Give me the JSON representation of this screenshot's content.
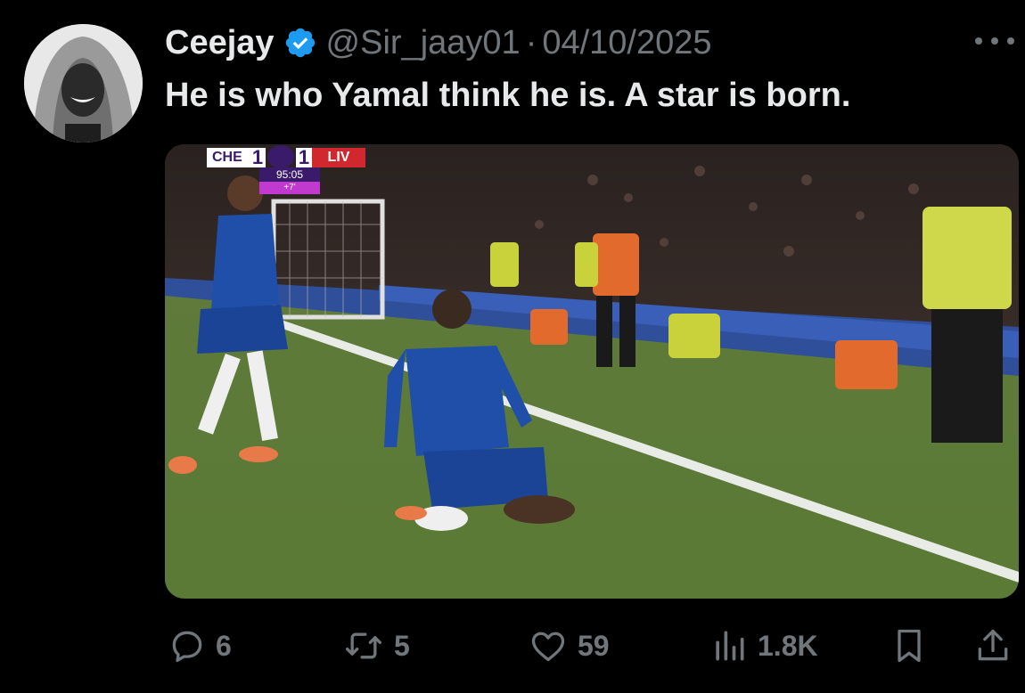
{
  "author": {
    "name": "Ceejay",
    "handle": "@Sir_jaay01",
    "separator": "·",
    "date": "04/10/2025",
    "verified": true,
    "verified_color": "#1d9bf0"
  },
  "tweet": {
    "text": "He is who Yamal think he is. A star is born."
  },
  "media": {
    "scorebug": {
      "home_team": "CHE",
      "home_score": "1",
      "away_score": "1",
      "away_team": "LIV",
      "clock": "95:05",
      "added_time": "+7'"
    }
  },
  "actions": {
    "replies": "6",
    "reposts": "5",
    "likes": "59",
    "views": "1.8K"
  },
  "colors": {
    "background": "#000000",
    "text": "#e7e9ea",
    "muted": "#71767b"
  }
}
